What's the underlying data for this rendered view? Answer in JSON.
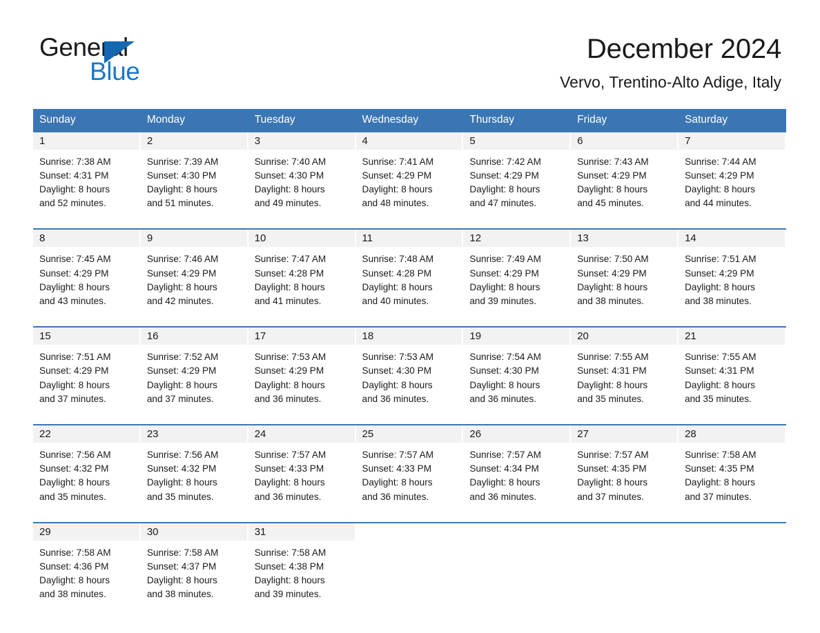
{
  "logo": {
    "word_one": "General",
    "word_two": "Blue",
    "triangle_icon": "triangle-icon",
    "brand_blue": "#1a78c8",
    "brand_dark_blue": "#1567b0"
  },
  "header": {
    "title": "December 2024",
    "location": "Vervo, Trentino-Alto Adige, Italy"
  },
  "colors": {
    "header_row": "#3b76b4",
    "day_band": "#f2f2f2",
    "text": "#1a1a1a"
  },
  "calendar": {
    "weekday_headers": [
      "Sunday",
      "Monday",
      "Tuesday",
      "Wednesday",
      "Thursday",
      "Friday",
      "Saturday"
    ],
    "weeks": [
      [
        {
          "day": "1",
          "lines": [
            "Sunrise: 7:38 AM",
            "Sunset: 4:31 PM",
            "Daylight: 8 hours",
            "and 52 minutes."
          ]
        },
        {
          "day": "2",
          "lines": [
            "Sunrise: 7:39 AM",
            "Sunset: 4:30 PM",
            "Daylight: 8 hours",
            "and 51 minutes."
          ]
        },
        {
          "day": "3",
          "lines": [
            "Sunrise: 7:40 AM",
            "Sunset: 4:30 PM",
            "Daylight: 8 hours",
            "and 49 minutes."
          ]
        },
        {
          "day": "4",
          "lines": [
            "Sunrise: 7:41 AM",
            "Sunset: 4:29 PM",
            "Daylight: 8 hours",
            "and 48 minutes."
          ]
        },
        {
          "day": "5",
          "lines": [
            "Sunrise: 7:42 AM",
            "Sunset: 4:29 PM",
            "Daylight: 8 hours",
            "and 47 minutes."
          ]
        },
        {
          "day": "6",
          "lines": [
            "Sunrise: 7:43 AM",
            "Sunset: 4:29 PM",
            "Daylight: 8 hours",
            "and 45 minutes."
          ]
        },
        {
          "day": "7",
          "lines": [
            "Sunrise: 7:44 AM",
            "Sunset: 4:29 PM",
            "Daylight: 8 hours",
            "and 44 minutes."
          ]
        }
      ],
      [
        {
          "day": "8",
          "lines": [
            "Sunrise: 7:45 AM",
            "Sunset: 4:29 PM",
            "Daylight: 8 hours",
            "and 43 minutes."
          ]
        },
        {
          "day": "9",
          "lines": [
            "Sunrise: 7:46 AM",
            "Sunset: 4:29 PM",
            "Daylight: 8 hours",
            "and 42 minutes."
          ]
        },
        {
          "day": "10",
          "lines": [
            "Sunrise: 7:47 AM",
            "Sunset: 4:28 PM",
            "Daylight: 8 hours",
            "and 41 minutes."
          ]
        },
        {
          "day": "11",
          "lines": [
            "Sunrise: 7:48 AM",
            "Sunset: 4:28 PM",
            "Daylight: 8 hours",
            "and 40 minutes."
          ]
        },
        {
          "day": "12",
          "lines": [
            "Sunrise: 7:49 AM",
            "Sunset: 4:29 PM",
            "Daylight: 8 hours",
            "and 39 minutes."
          ]
        },
        {
          "day": "13",
          "lines": [
            "Sunrise: 7:50 AM",
            "Sunset: 4:29 PM",
            "Daylight: 8 hours",
            "and 38 minutes."
          ]
        },
        {
          "day": "14",
          "lines": [
            "Sunrise: 7:51 AM",
            "Sunset: 4:29 PM",
            "Daylight: 8 hours",
            "and 38 minutes."
          ]
        }
      ],
      [
        {
          "day": "15",
          "lines": [
            "Sunrise: 7:51 AM",
            "Sunset: 4:29 PM",
            "Daylight: 8 hours",
            "and 37 minutes."
          ]
        },
        {
          "day": "16",
          "lines": [
            "Sunrise: 7:52 AM",
            "Sunset: 4:29 PM",
            "Daylight: 8 hours",
            "and 37 minutes."
          ]
        },
        {
          "day": "17",
          "lines": [
            "Sunrise: 7:53 AM",
            "Sunset: 4:29 PM",
            "Daylight: 8 hours",
            "and 36 minutes."
          ]
        },
        {
          "day": "18",
          "lines": [
            "Sunrise: 7:53 AM",
            "Sunset: 4:30 PM",
            "Daylight: 8 hours",
            "and 36 minutes."
          ]
        },
        {
          "day": "19",
          "lines": [
            "Sunrise: 7:54 AM",
            "Sunset: 4:30 PM",
            "Daylight: 8 hours",
            "and 36 minutes."
          ]
        },
        {
          "day": "20",
          "lines": [
            "Sunrise: 7:55 AM",
            "Sunset: 4:31 PM",
            "Daylight: 8 hours",
            "and 35 minutes."
          ]
        },
        {
          "day": "21",
          "lines": [
            "Sunrise: 7:55 AM",
            "Sunset: 4:31 PM",
            "Daylight: 8 hours",
            "and 35 minutes."
          ]
        }
      ],
      [
        {
          "day": "22",
          "lines": [
            "Sunrise: 7:56 AM",
            "Sunset: 4:32 PM",
            "Daylight: 8 hours",
            "and 35 minutes."
          ]
        },
        {
          "day": "23",
          "lines": [
            "Sunrise: 7:56 AM",
            "Sunset: 4:32 PM",
            "Daylight: 8 hours",
            "and 35 minutes."
          ]
        },
        {
          "day": "24",
          "lines": [
            "Sunrise: 7:57 AM",
            "Sunset: 4:33 PM",
            "Daylight: 8 hours",
            "and 36 minutes."
          ]
        },
        {
          "day": "25",
          "lines": [
            "Sunrise: 7:57 AM",
            "Sunset: 4:33 PM",
            "Daylight: 8 hours",
            "and 36 minutes."
          ]
        },
        {
          "day": "26",
          "lines": [
            "Sunrise: 7:57 AM",
            "Sunset: 4:34 PM",
            "Daylight: 8 hours",
            "and 36 minutes."
          ]
        },
        {
          "day": "27",
          "lines": [
            "Sunrise: 7:57 AM",
            "Sunset: 4:35 PM",
            "Daylight: 8 hours",
            "and 37 minutes."
          ]
        },
        {
          "day": "28",
          "lines": [
            "Sunrise: 7:58 AM",
            "Sunset: 4:35 PM",
            "Daylight: 8 hours",
            "and 37 minutes."
          ]
        }
      ],
      [
        {
          "day": "29",
          "lines": [
            "Sunrise: 7:58 AM",
            "Sunset: 4:36 PM",
            "Daylight: 8 hours",
            "and 38 minutes."
          ]
        },
        {
          "day": "30",
          "lines": [
            "Sunrise: 7:58 AM",
            "Sunset: 4:37 PM",
            "Daylight: 8 hours",
            "and 38 minutes."
          ]
        },
        {
          "day": "31",
          "lines": [
            "Sunrise: 7:58 AM",
            "Sunset: 4:38 PM",
            "Daylight: 8 hours",
            "and 39 minutes."
          ]
        },
        {
          "day": "",
          "lines": []
        },
        {
          "day": "",
          "lines": []
        },
        {
          "day": "",
          "lines": []
        },
        {
          "day": "",
          "lines": []
        }
      ]
    ]
  }
}
